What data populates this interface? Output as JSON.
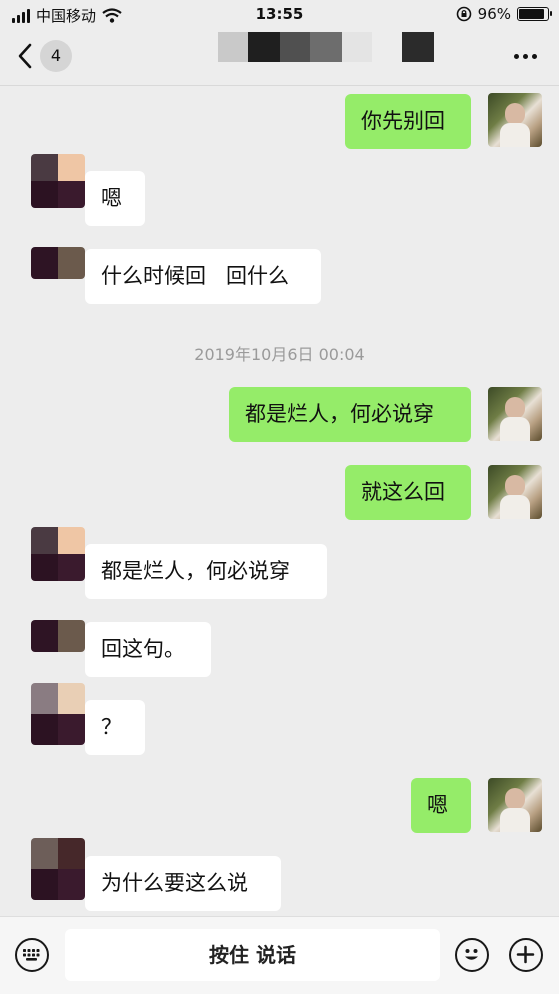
{
  "status_bar": {
    "carrier": "中国移动",
    "time": "13:55",
    "battery": "96%",
    "battery_level": 0.96,
    "icons": [
      "signal-icon",
      "wifi-icon",
      "orientation-lock-icon",
      "battery-icon"
    ]
  },
  "nav": {
    "unread_count": "4",
    "back_icon": "chevron-left-icon",
    "more_icon": "more-dots-icon"
  },
  "messages": [
    {
      "side": "right",
      "text": "你先别回"
    },
    {
      "side": "left",
      "text": "嗯"
    },
    {
      "side": "left",
      "text": "什么时候回   回什么"
    },
    {
      "type": "time",
      "text": "2019年10月6日 00:04"
    },
    {
      "side": "right",
      "text": "都是烂人，何必说穿"
    },
    {
      "side": "right",
      "text": "就这么回"
    },
    {
      "side": "left",
      "text": "都是烂人，何必说穿"
    },
    {
      "side": "left",
      "text": "回这句。"
    },
    {
      "side": "left",
      "text": "？"
    },
    {
      "side": "right",
      "text": "嗯"
    },
    {
      "side": "left",
      "text": "为什么要这么说"
    }
  ],
  "input_bar": {
    "voice_label": "按住 说话",
    "icons": [
      "keyboard-icon",
      "emoji-icon",
      "plus-icon"
    ]
  },
  "colors": {
    "background": "#ededed",
    "bubble_self": "#95ec69",
    "bubble_other": "#ffffff",
    "timestamp": "#9a9a9a"
  }
}
